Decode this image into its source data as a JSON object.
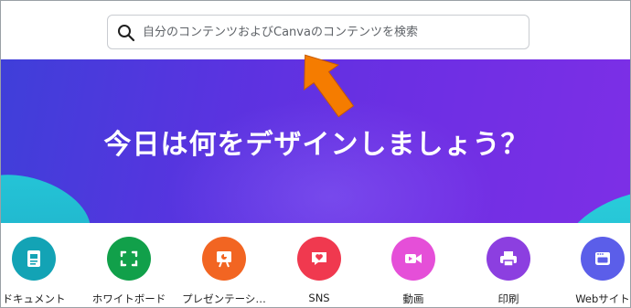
{
  "search": {
    "placeholder": "自分のコンテンツおよびCanvaのコンテンツを検索"
  },
  "hero": {
    "title": "今日は何をデザインしましょう？"
  },
  "categories": [
    {
      "label": "ドキュメント",
      "icon": "document-icon",
      "color": "#13a3b5"
    },
    {
      "label": "ホワイトボード",
      "icon": "whiteboard-icon",
      "color": "#11a04a"
    },
    {
      "label": "プレゼンテーシ…",
      "icon": "presentation-icon",
      "color": "#f26522"
    },
    {
      "label": "SNS",
      "icon": "heart-chat-icon",
      "color": "#f0394f"
    },
    {
      "label": "動画",
      "icon": "video-camera-icon",
      "color": "#e54fd8"
    },
    {
      "label": "印刷",
      "icon": "printer-icon",
      "color": "#8c3fe0"
    },
    {
      "label": "Webサイト",
      "icon": "website-icon",
      "color": "#5b5ee9"
    }
  ],
  "colors": {
    "arrow": "#f57c00",
    "hero_start": "#3f3fd9",
    "hero_end": "#7d2fe6",
    "accent_teal": "#25c7d9"
  }
}
